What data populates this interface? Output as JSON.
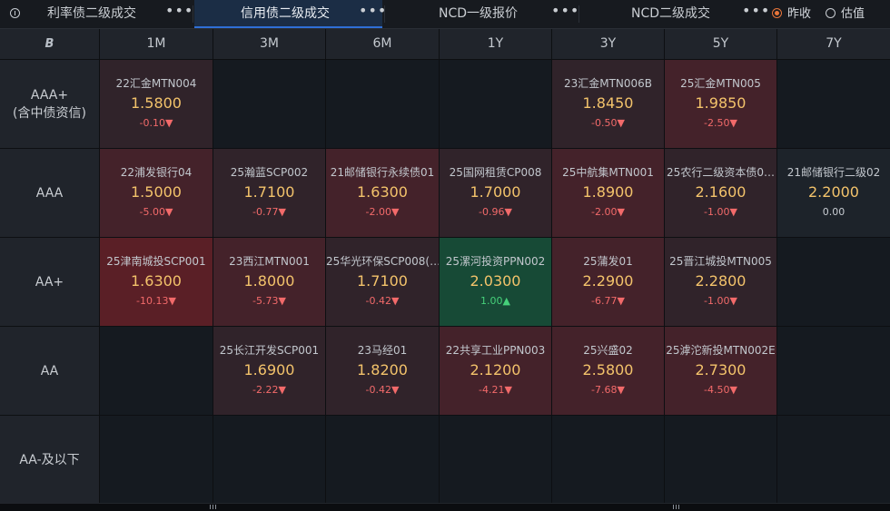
{
  "tabs": [
    {
      "label": "利率债二级成交",
      "more": "•••"
    },
    {
      "label": "信用债二级成交",
      "more": "•••"
    },
    {
      "label": "NCD一级报价",
      "more": "•••"
    },
    {
      "label": "NCD二级成交",
      "more": "•••"
    }
  ],
  "price_mode": {
    "options": [
      "昨收",
      "估值"
    ],
    "selected": "昨收"
  },
  "header": {
    "logo": "B",
    "columns": [
      "1M",
      "3M",
      "6M",
      "1Y",
      "3Y",
      "5Y",
      "7Y"
    ]
  },
  "rows": [
    {
      "label": "AAA+\n(含中债资信)",
      "cells": [
        {
          "name": "22汇金MTN004",
          "yield": "1.5800",
          "change": "-0.10▼",
          "dir": "down",
          "tone": "light"
        },
        null,
        null,
        null,
        {
          "name": "23汇金MTN006B",
          "yield": "1.8450",
          "change": "-0.50▼",
          "dir": "down",
          "tone": "light"
        },
        {
          "name": "25汇金MTN005",
          "yield": "1.9850",
          "change": "-2.50▼",
          "dir": "down",
          "tone": "mid"
        },
        null
      ]
    },
    {
      "label": "AAA",
      "cells": [
        {
          "name": "22浦发银行04",
          "yield": "1.5000",
          "change": "-5.00▼",
          "dir": "down",
          "tone": "mid"
        },
        {
          "name": "25瀚蓝SCP002",
          "yield": "1.7100",
          "change": "-0.77▼",
          "dir": "down",
          "tone": "light"
        },
        {
          "name": "21邮储银行永续债01",
          "yield": "1.6300",
          "change": "-2.00▼",
          "dir": "down",
          "tone": "mid"
        },
        {
          "name": "25国网租赁CP008",
          "yield": "1.7000",
          "change": "-0.96▼",
          "dir": "down",
          "tone": "light"
        },
        {
          "name": "25中航集MTN001",
          "yield": "1.8900",
          "change": "-2.00▼",
          "dir": "down",
          "tone": "mid"
        },
        {
          "name": "25农行二级资本债0…",
          "yield": "2.1600",
          "change": "-1.00▼",
          "dir": "down",
          "tone": "light"
        },
        {
          "name": "21邮储银行二级02",
          "yield": "2.2000",
          "change": "0.00",
          "dir": "flat",
          "tone": "neutral"
        }
      ]
    },
    {
      "label": "AA+",
      "cells": [
        {
          "name": "25津南城投SCP001",
          "yield": "1.6300",
          "change": "-10.13▼",
          "dir": "down",
          "tone": "strong"
        },
        {
          "name": "23西江MTN001",
          "yield": "1.8000",
          "change": "-5.73▼",
          "dir": "down",
          "tone": "mid"
        },
        {
          "name": "25华光环保SCP008(…",
          "yield": "1.7100",
          "change": "-0.42▼",
          "dir": "down",
          "tone": "light"
        },
        {
          "name": "25漯河投资PPN002",
          "yield": "2.0300",
          "change": "1.00▲",
          "dir": "up",
          "tone": "green"
        },
        {
          "name": "25蒲发01",
          "yield": "2.2900",
          "change": "-6.77▼",
          "dir": "down",
          "tone": "mid"
        },
        {
          "name": "25晋江城投MTN005",
          "yield": "2.2800",
          "change": "-1.00▼",
          "dir": "down",
          "tone": "light"
        },
        null
      ]
    },
    {
      "label": "AA",
      "cells": [
        null,
        {
          "name": "25长江开发SCP001",
          "yield": "1.6900",
          "change": "-2.22▼",
          "dir": "down",
          "tone": "light"
        },
        {
          "name": "23马经01",
          "yield": "1.8200",
          "change": "-0.42▼",
          "dir": "down",
          "tone": "light"
        },
        {
          "name": "22共享工业PPN003",
          "yield": "2.1200",
          "change": "-4.21▼",
          "dir": "down",
          "tone": "mid"
        },
        {
          "name": "25兴盛02",
          "yield": "2.5800",
          "change": "-7.68▼",
          "dir": "down",
          "tone": "mid"
        },
        {
          "name": "25滹沱新投MTN002E",
          "yield": "2.7300",
          "change": "-4.50▼",
          "dir": "down",
          "tone": "mid"
        },
        null
      ]
    },
    {
      "label": "AA-及以下",
      "cells": [
        null,
        null,
        null,
        null,
        null,
        null,
        null
      ]
    }
  ],
  "colors": {
    "accent": "#2f6fd6",
    "radio_on": "#e8753a",
    "yield_text": "#f3c36b",
    "down": "#f26a6a",
    "up": "#46d07a",
    "tone_strong": "#5a1f26",
    "tone_mid": "#44222a",
    "tone_light": "#30232a",
    "tone_green": "#174a36",
    "tone_neutral": "#1d232a",
    "empty": "#151a20"
  }
}
